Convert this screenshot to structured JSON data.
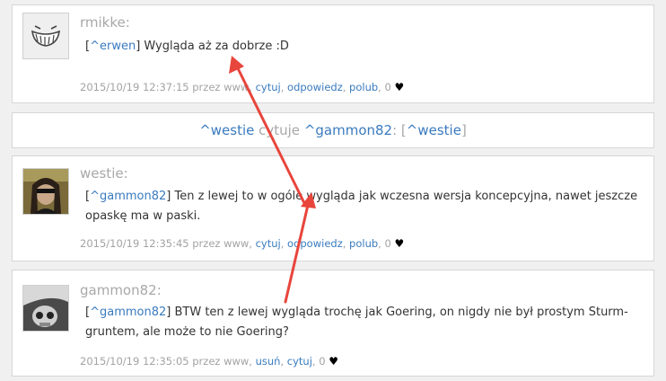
{
  "comments": [
    {
      "username": "rmikke:",
      "reply_to": "^erwen",
      "text": " Wygląda aż za dobrze :D",
      "timestamp": "2015/10/19 12:37:15",
      "via": " przez www, ",
      "actions": [
        "cytuj",
        "odpowiedz",
        "polub"
      ],
      "likes": "0"
    },
    {
      "username": "westie:",
      "reply_to": "^gammon82",
      "text": " Ten z lewej to w ogóle wygląda jak wczesna wersja koncepcyjna, nawet jeszcze opaskę ma w paski.",
      "timestamp": "2015/10/19 12:35:45",
      "via": " przez www, ",
      "actions": [
        "cytuj",
        "odpowiedz",
        "polub"
      ],
      "likes": "0"
    },
    {
      "username": "gammon82:",
      "reply_to": "^gammon82",
      "text": " BTW ten z lewej wygląda trochę jak Goering, on nigdy nie był prostym Sturm- gruntem, ale może to nie Goering?",
      "timestamp": "2015/10/19 12:35:05",
      "via": " przez www, ",
      "actions": [
        "usuń",
        "cytuj"
      ],
      "likes": "0"
    }
  ],
  "quote_bar": {
    "author": "^westie",
    "verb": " cytuje ",
    "target": "^gammon82",
    "separator": ": [",
    "quoted": "^westie",
    "close": "]"
  },
  "colors": {
    "link": "#3a7bbf",
    "annotation_arrow": "#e8453c"
  },
  "icons": [
    "heart-icon"
  ]
}
